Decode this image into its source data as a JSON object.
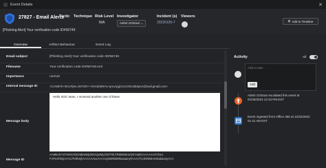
{
  "window": {
    "title": "Event Details"
  },
  "header": {
    "incident_name": "27827 - Email Alerts",
    "tactic_label": "Tactic",
    "technique_label": "Technique",
    "risk_label": "Risk Level",
    "risk_value": "N/A",
    "investigator_label": "Investigator",
    "investigator_value": "Admin D3Soar",
    "incident_label": "Incident (s)",
    "incident_value": "20230105-7",
    "viewers_label": "Viewers",
    "add_timeline": "Add to Timeline",
    "subject": "[Phishing Alert] Your verification code ID#56749"
  },
  "tabs": [
    "Overview",
    "Artifact Behaviour",
    "Event Log"
  ],
  "fields": {
    "email_subject_k": "Email subject",
    "email_subject_v": "[Phishing Alert] Your verification code ID#56749",
    "filename_k": "Filename",
    "filename_v": "Your verification code ID#56749.eml",
    "importance_k": "Importance",
    "importance_v": "normal",
    "internal_id_k": "Internal message ID",
    "internal_id_v": "<CAN8Yh+rkCvFjNv=ksTGR++VKX2iWNYu+qAuApjjCncUVDLNbZpsA@mail.gmail.com>",
    "message_body_k": "Message body",
    "message_body_v": "Hello SOC team, I received another one of these",
    "message_id_k": "Message ID",
    "message_id_v1": "AAMkADYZYWOOGEzMEwNjUtNGQwMy1hZTRiLTRMWWUxODYwBGAAAAAAGYEeJ",
    "message_id_v2": "FVPed7BQAAAC/FdRmjhAAAAAAxxAAAAnyNMNMWkaaaanyfAAAATCdGRB9AmIkakaanyAAA"
  },
  "activity": {
    "title": "Activity",
    "toggle_label": "All",
    "note_placeholder": "Add a note...",
    "add_button": "Add",
    "event1_line1": "Admin D3Soar escalated this event at",
    "event1_line2": "01/05/2023 12:43 PM EST",
    "event2_line1": "Event ingested from Office 365 at 12/22/2022",
    "event2_line2": "01:41 AM EST"
  },
  "colors": {
    "accent": "#e8622a",
    "timeline_blue": "#2a76c9"
  }
}
